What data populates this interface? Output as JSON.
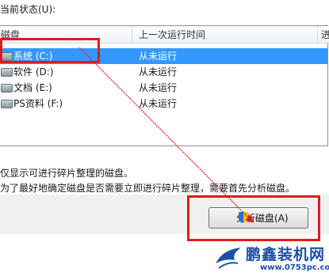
{
  "status": {
    "label": "当前状态(U):"
  },
  "columns": {
    "disk": "磁盘",
    "last_run": "上一次运行时间",
    "extra": "进"
  },
  "disks": [
    {
      "name": "系统 (C:)",
      "last_run": "从未运行",
      "selected": true
    },
    {
      "name": "软件 (D:)",
      "last_run": "从未运行",
      "selected": false
    },
    {
      "name": "文档 (E:)",
      "last_run": "从未运行",
      "selected": false
    },
    {
      "name": "PS资料 (F:)",
      "last_run": "从未运行",
      "selected": false
    }
  ],
  "info": {
    "line1": "仅显示可进行碎片整理的磁盘。",
    "line2": "为了最好地确定磁盘是否需要立即进行碎片整理，需要首先分析磁盘。"
  },
  "analyze_button": {
    "label": "分析磁盘(A)",
    "icon": "uac-shield-icon"
  },
  "watermark": {
    "title": "鹏鑫装机网",
    "url": "www.0753pc.com"
  },
  "colors": {
    "selection": "#3399ff",
    "highlight_box": "#e01c1c",
    "watermark": "#1d4fa8"
  }
}
